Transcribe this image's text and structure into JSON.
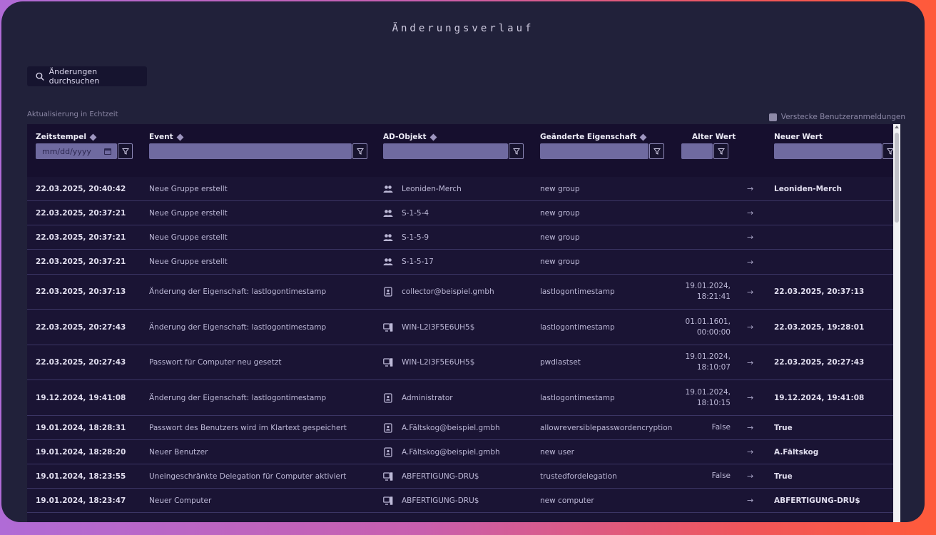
{
  "title": "Änderungsverlauf",
  "search_button": {
    "label": "Änderungen durchsuchen",
    "icon": "search-icon"
  },
  "realtime_label": "Aktualisierung in Echtzeit",
  "hide_logins_label": "Verstecke Benutzeranmeldungen",
  "columns": {
    "timestamp": "Zeitstempel",
    "event": "Event",
    "object": "AD-Objekt",
    "property": "Geänderte Eigenschaft",
    "old": "Alter Wert",
    "new": "Neuer Wert"
  },
  "date_placeholder": "mm/dd/yyyy",
  "arrow": "→",
  "rows": [
    {
      "time": "22.03.2025, 20:40:42",
      "event": "Neue Gruppe erstellt",
      "icon": "group",
      "object": "Leoniden-Merch",
      "property": "new group",
      "old": "",
      "old2": "",
      "new": "Leoniden-Merch"
    },
    {
      "time": "22.03.2025, 20:37:21",
      "event": "Neue Gruppe erstellt",
      "icon": "group",
      "object": "S-1-5-4",
      "property": "new group",
      "old": "",
      "old2": "",
      "new": ""
    },
    {
      "time": "22.03.2025, 20:37:21",
      "event": "Neue Gruppe erstellt",
      "icon": "group",
      "object": "S-1-5-9",
      "property": "new group",
      "old": "",
      "old2": "",
      "new": ""
    },
    {
      "time": "22.03.2025, 20:37:21",
      "event": "Neue Gruppe erstellt",
      "icon": "group",
      "object": "S-1-5-17",
      "property": "new group",
      "old": "",
      "old2": "",
      "new": ""
    },
    {
      "time": "22.03.2025, 20:37:13",
      "event": "Änderung der Eigenschaft: lastlogontimestamp",
      "icon": "user",
      "object": "collector@beispiel.gmbh",
      "property": "lastlogontimestamp",
      "old": "19.01.2024,",
      "old2": "18:21:41",
      "new": "22.03.2025, 20:37:13"
    },
    {
      "time": "22.03.2025, 20:27:43",
      "event": "Änderung der Eigenschaft: lastlogontimestamp",
      "icon": "computer",
      "object": "WIN-L2I3F5E6UH5$",
      "property": "lastlogontimestamp",
      "old": "01.01.1601,",
      "old2": "00:00:00",
      "new": "22.03.2025, 19:28:01"
    },
    {
      "time": "22.03.2025, 20:27:43",
      "event": "Passwort für Computer neu gesetzt",
      "icon": "computer",
      "object": "WIN-L2I3F5E6UH5$",
      "property": "pwdlastset",
      "old": "19.01.2024,",
      "old2": "18:10:07",
      "new": "22.03.2025, 20:27:43"
    },
    {
      "time": "19.12.2024, 19:41:08",
      "event": "Änderung der Eigenschaft: lastlogontimestamp",
      "icon": "user",
      "object": "Administrator",
      "property": "lastlogontimestamp",
      "old": "19.01.2024,",
      "old2": "18:10:15",
      "new": "19.12.2024, 19:41:08"
    },
    {
      "time": "19.01.2024, 18:28:31",
      "event": "Passwort des Benutzers wird im Klartext gespeichert",
      "icon": "user",
      "object": "A.Fältskog@beispiel.gmbh",
      "property": "allowreversiblepasswordencryption",
      "old": "False",
      "old2": "",
      "new": "True"
    },
    {
      "time": "19.01.2024, 18:28:20",
      "event": "Neuer Benutzer",
      "icon": "user",
      "object": "A.Fältskog@beispiel.gmbh",
      "property": "new user",
      "old": "",
      "old2": "",
      "new": "A.Fältskog"
    },
    {
      "time": "19.01.2024, 18:23:55",
      "event": "Uneingeschränkte Delegation für Computer aktiviert",
      "icon": "computer",
      "object": "ABFERTIGUNG-DRU$",
      "property": "trustedfordelegation",
      "old": "False",
      "old2": "",
      "new": "True"
    },
    {
      "time": "19.01.2024, 18:23:47",
      "event": "Neuer Computer",
      "icon": "computer",
      "object": "ABFERTIGUNG-DRU$",
      "property": "new computer",
      "old": "",
      "old2": "",
      "new": "ABFERTIGUNG-DRU$"
    }
  ]
}
